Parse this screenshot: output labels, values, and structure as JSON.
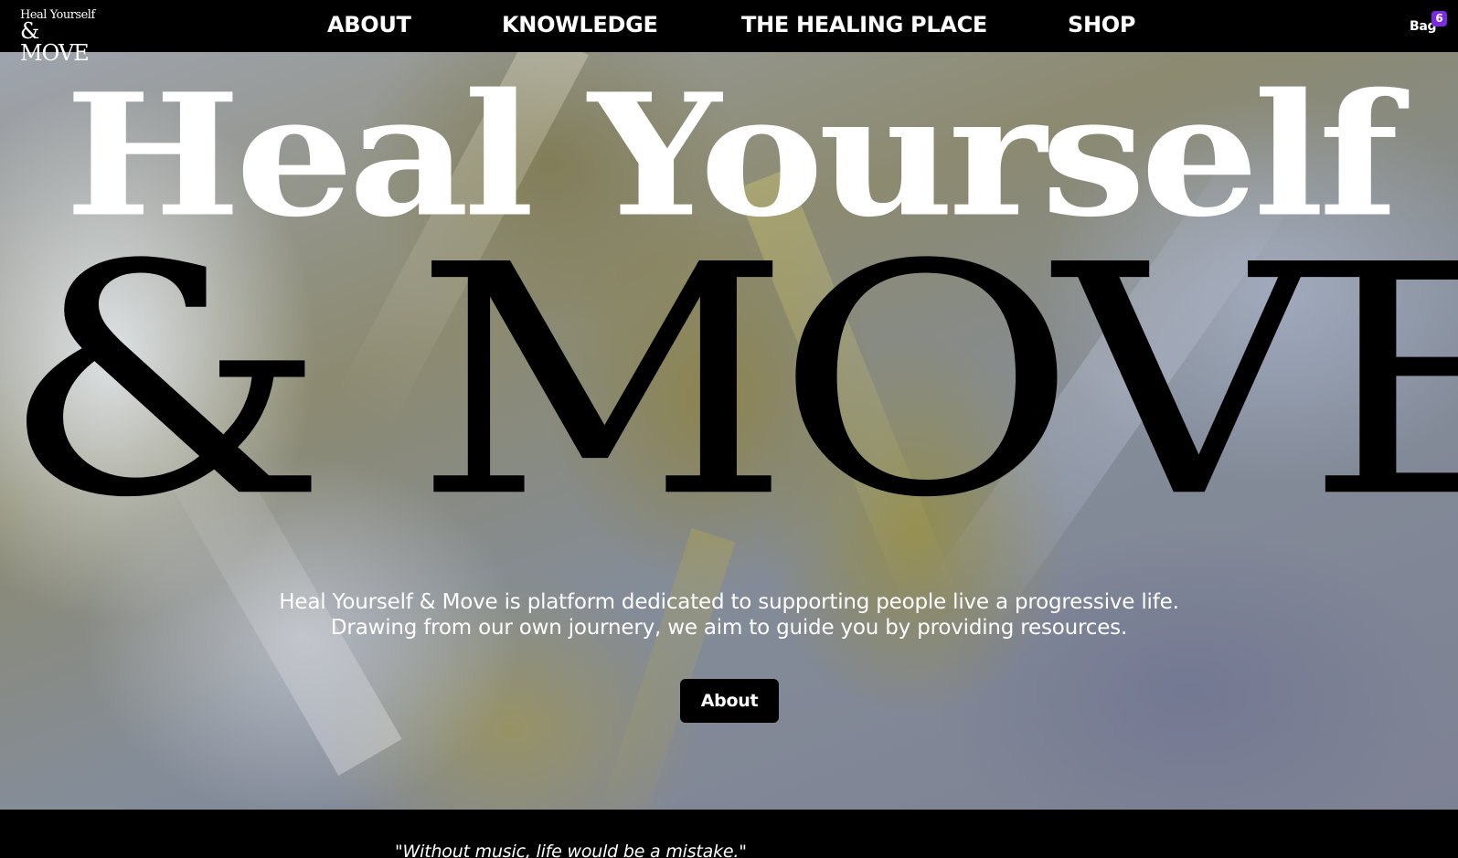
{
  "brand": {
    "logo_line1": "Heal Yourself",
    "logo_line2": "& MOVE"
  },
  "nav": {
    "items": [
      {
        "label": "ABOUT"
      },
      {
        "label": "KNOWLEDGE"
      },
      {
        "label": "THE HEALING PLACE"
      },
      {
        "label": "SHOP"
      }
    ]
  },
  "bag": {
    "label": "Bag",
    "count": "6"
  },
  "hero": {
    "headline_line1": "Heal Yourself",
    "headline_line2": "& MOVE",
    "tagline_line1": "Heal Yourself & Move is platform dedicated to supporting people live a progressive life.",
    "tagline_line2": "Drawing from our own journery, we aim to guide you by providing resources.",
    "cta_label": "About"
  },
  "quote": {
    "text": "\"Without music, life would be a mistake.\""
  },
  "colors": {
    "header_bg": "#000000",
    "badge": "#7a2be0",
    "button_bg": "#000000",
    "text": "#ffffff"
  }
}
